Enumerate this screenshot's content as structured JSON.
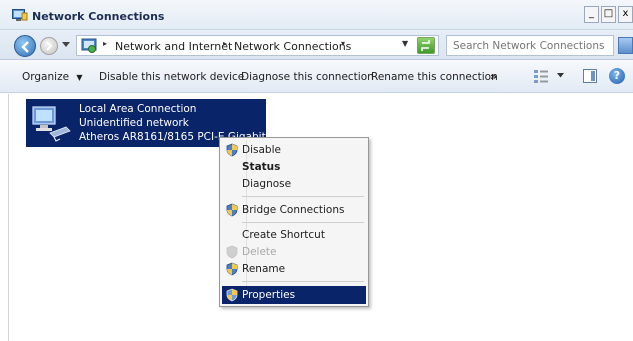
{
  "window": {
    "title": "Network Connections",
    "controls": {
      "minimize": "_",
      "maximize": "□",
      "close": "x"
    }
  },
  "address_bar": {
    "breadcrumbs": [
      "Network and Internet",
      "Network Connections"
    ],
    "search_placeholder": "Search Network Connections"
  },
  "command_bar": {
    "items": [
      "Organize",
      "Disable this network device",
      "Diagnose this connection",
      "Rename this connection"
    ],
    "more": "»",
    "help": "?"
  },
  "connection": {
    "name": "Local Area Connection",
    "status": "Unidentified network",
    "adapter": "Atheros AR8161/8165 PCI-E Gigabit"
  },
  "context_menu": {
    "items": [
      {
        "label": "Disable",
        "icon": "uac-shield-icon",
        "style": "normal"
      },
      {
        "label": "Status",
        "style": "bold"
      },
      {
        "label": "Diagnose",
        "style": "normal"
      },
      {
        "label": "Bridge Connections",
        "icon": "uac-shield-icon",
        "style": "normal"
      },
      {
        "label": "Create Shortcut",
        "style": "normal"
      },
      {
        "label": "Delete",
        "icon": "uac-shield-icon",
        "style": "disabled"
      },
      {
        "label": "Rename",
        "icon": "uac-shield-icon",
        "style": "normal"
      },
      {
        "label": "Properties",
        "icon": "uac-shield-icon",
        "style": "selected"
      }
    ]
  },
  "colors": {
    "selection": "#0a246a",
    "menu_background": "#f5f5f5",
    "disabled_text": "#a8a8a8"
  }
}
